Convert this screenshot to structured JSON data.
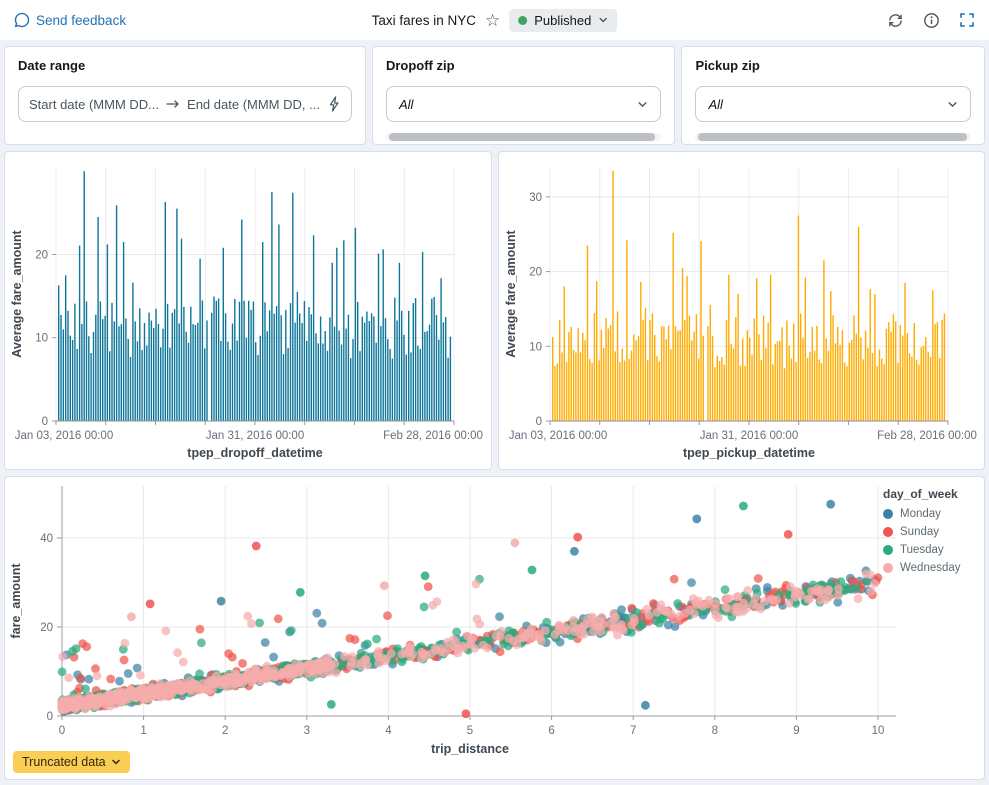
{
  "header": {
    "feedback_label": "Send feedback",
    "title": "Taxi fares in NYC",
    "status": "Published",
    "status_color": "#3BA45D",
    "accent_color": "#2272B4",
    "icons": {
      "feedback": "speech-bubble",
      "favorite": "star-outline",
      "status_dropdown": "chevron-down",
      "refresh": "circular-arrows",
      "info": "info-circle",
      "fullscreen": "expand-corners"
    },
    "star_glyph": "☆"
  },
  "filters": {
    "date_range": {
      "title": "Date range",
      "start_placeholder": "Start date (MMM DD...",
      "end_placeholder": "End date (MMM DD, ...",
      "icons": {
        "range_arrow": "arrow-right",
        "shortcut": "lightning-bolt"
      }
    },
    "dropoff_zip": {
      "title": "Dropoff zip",
      "value": "All"
    },
    "pickup_zip": {
      "title": "Pickup zip",
      "value": "All"
    }
  },
  "chart_data": [
    {
      "id": "avg-fare-by-dropoff",
      "type": "bar",
      "title": "",
      "xlabel": "tpep_dropoff_datetime",
      "ylabel": "Average fare_amount",
      "x_ticks": [
        "Jan 03, 2016 00:00",
        "Jan 31, 2016 00:00",
        "Feb 28, 2016 00:00"
      ],
      "y_ticks": [
        0,
        10,
        20
      ],
      "ylim": [
        0,
        30.5
      ],
      "color": "#0E7699",
      "grid": true,
      "n_bars": 170,
      "base_range": [
        7.5,
        15
      ],
      "spike_prob": 0.12,
      "spike_extra_max": 9,
      "gap_frac": 0.385,
      "seed": 7,
      "peaks": [
        {
          "f": 0.02,
          "v": 17.5
        },
        {
          "f": 0.065,
          "v": 30.0
        },
        {
          "f": 0.1,
          "v": 24.5
        },
        {
          "f": 0.125,
          "v": 21.2
        },
        {
          "f": 0.145,
          "v": 25.9
        },
        {
          "f": 0.165,
          "v": 21.5
        },
        {
          "f": 0.27,
          "v": 26.3
        },
        {
          "f": 0.3,
          "v": 25.5
        },
        {
          "f": 0.315,
          "v": 21.9
        },
        {
          "f": 0.36,
          "v": 19.5
        },
        {
          "f": 0.42,
          "v": 20.8
        },
        {
          "f": 0.47,
          "v": 24.2
        },
        {
          "f": 0.52,
          "v": 21.5
        },
        {
          "f": 0.545,
          "v": 27.5
        },
        {
          "f": 0.565,
          "v": 23.6
        },
        {
          "f": 0.6,
          "v": 27.4
        },
        {
          "f": 0.65,
          "v": 22.3
        },
        {
          "f": 0.7,
          "v": 19.0
        },
        {
          "f": 0.73,
          "v": 21.7
        },
        {
          "f": 0.76,
          "v": 23.2
        },
        {
          "f": 0.83,
          "v": 20.6
        },
        {
          "f": 0.87,
          "v": 19.0
        },
        {
          "f": 0.93,
          "v": 20.3
        },
        {
          "f": 0.96,
          "v": 14.9
        }
      ]
    },
    {
      "id": "avg-fare-by-pickup",
      "type": "bar",
      "title": "",
      "xlabel": "tpep_pickup_datetime",
      "ylabel": "Average fare_amount",
      "x_ticks": [
        "Jan 03, 2016 00:00",
        "Jan 31, 2016 00:00",
        "Feb 28, 2016 00:00"
      ],
      "y_ticks": [
        0,
        10,
        20,
        30
      ],
      "ylim": [
        0,
        34
      ],
      "color": "#FFAB00",
      "grid": true,
      "n_bars": 170,
      "base_range": [
        7,
        14.5
      ],
      "spike_prob": 0.12,
      "spike_extra_max": 10,
      "gap_frac": 0.388,
      "seed": 13,
      "peaks": [
        {
          "f": 0.03,
          "v": 18.0
        },
        {
          "f": 0.09,
          "v": 23.5
        },
        {
          "f": 0.115,
          "v": 18.7
        },
        {
          "f": 0.155,
          "v": 33.5
        },
        {
          "f": 0.19,
          "v": 24.2
        },
        {
          "f": 0.225,
          "v": 18.6
        },
        {
          "f": 0.31,
          "v": 25.2
        },
        {
          "f": 0.345,
          "v": 19.4
        },
        {
          "f": 0.38,
          "v": 24.1
        },
        {
          "f": 0.45,
          "v": 19.6
        },
        {
          "f": 0.52,
          "v": 19.1
        },
        {
          "f": 0.555,
          "v": 19.6
        },
        {
          "f": 0.63,
          "v": 27.5
        },
        {
          "f": 0.645,
          "v": 19.2
        },
        {
          "f": 0.69,
          "v": 21.5
        },
        {
          "f": 0.78,
          "v": 26.0
        },
        {
          "f": 0.82,
          "v": 17.0
        },
        {
          "f": 0.9,
          "v": 18.5
        },
        {
          "f": 0.97,
          "v": 17.5
        }
      ]
    },
    {
      "id": "fare-vs-distance",
      "type": "scatter",
      "title": "",
      "xlabel": "trip_distance",
      "ylabel": "fare_amount",
      "x_ticks": [
        0,
        1,
        2,
        3,
        4,
        5,
        6,
        7,
        8,
        9,
        10
      ],
      "y_ticks": [
        0,
        20,
        40
      ],
      "xlim": [
        0,
        10.3
      ],
      "ylim": [
        0,
        52
      ],
      "grid": true,
      "legend_title": "day_of_week",
      "legend_position": "right-top",
      "marker": {
        "radius": 4.4,
        "opacity": 0.72
      },
      "trend": {
        "intercept": 2.3,
        "slope": 2.75,
        "noise": 1.15
      },
      "seed": 42,
      "series": [
        {
          "name": "Monday",
          "color": "#3D82A5",
          "n": 520
        },
        {
          "name": "Sunday",
          "color": "#F0544C",
          "n": 520
        },
        {
          "name": "Tuesday",
          "color": "#2BAA7D",
          "n": 560
        },
        {
          "name": "Wednesday",
          "color": "#F7ACAC",
          "n": 680
        }
      ],
      "outliers": [
        {
          "x": 2.38,
          "y": 38.2,
          "s": "Sunday"
        },
        {
          "x": 6.32,
          "y": 40.2,
          "s": "Sunday"
        },
        {
          "x": 6.28,
          "y": 37.0,
          "s": "Monday"
        },
        {
          "x": 5.55,
          "y": 38.9,
          "s": "Wednesday"
        },
        {
          "x": 5.76,
          "y": 32.8,
          "s": "Tuesday"
        },
        {
          "x": 9.42,
          "y": 47.6,
          "s": "Monday"
        },
        {
          "x": 8.35,
          "y": 47.2,
          "s": "Tuesday"
        },
        {
          "x": 7.78,
          "y": 44.3,
          "s": "Monday"
        },
        {
          "x": 8.9,
          "y": 40.8,
          "s": "Sunday"
        },
        {
          "x": 4.95,
          "y": 0.5,
          "s": "Sunday"
        },
        {
          "x": 3.3,
          "y": 2.6,
          "s": "Tuesday"
        },
        {
          "x": 7.15,
          "y": 2.4,
          "s": "Monday"
        },
        {
          "x": 1.08,
          "y": 25.2,
          "s": "Sunday"
        },
        {
          "x": 1.95,
          "y": 25.8,
          "s": "Monday"
        },
        {
          "x": 0.85,
          "y": 22.3,
          "s": "Wednesday"
        },
        {
          "x": 3.95,
          "y": 29.3,
          "s": "Wednesday"
        },
        {
          "x": 2.92,
          "y": 27.8,
          "s": "Tuesday"
        },
        {
          "x": 4.45,
          "y": 31.5,
          "s": "Tuesday"
        }
      ]
    }
  ],
  "footer": {
    "truncated_label": "Truncated data",
    "badge_color": "#FACE54"
  }
}
